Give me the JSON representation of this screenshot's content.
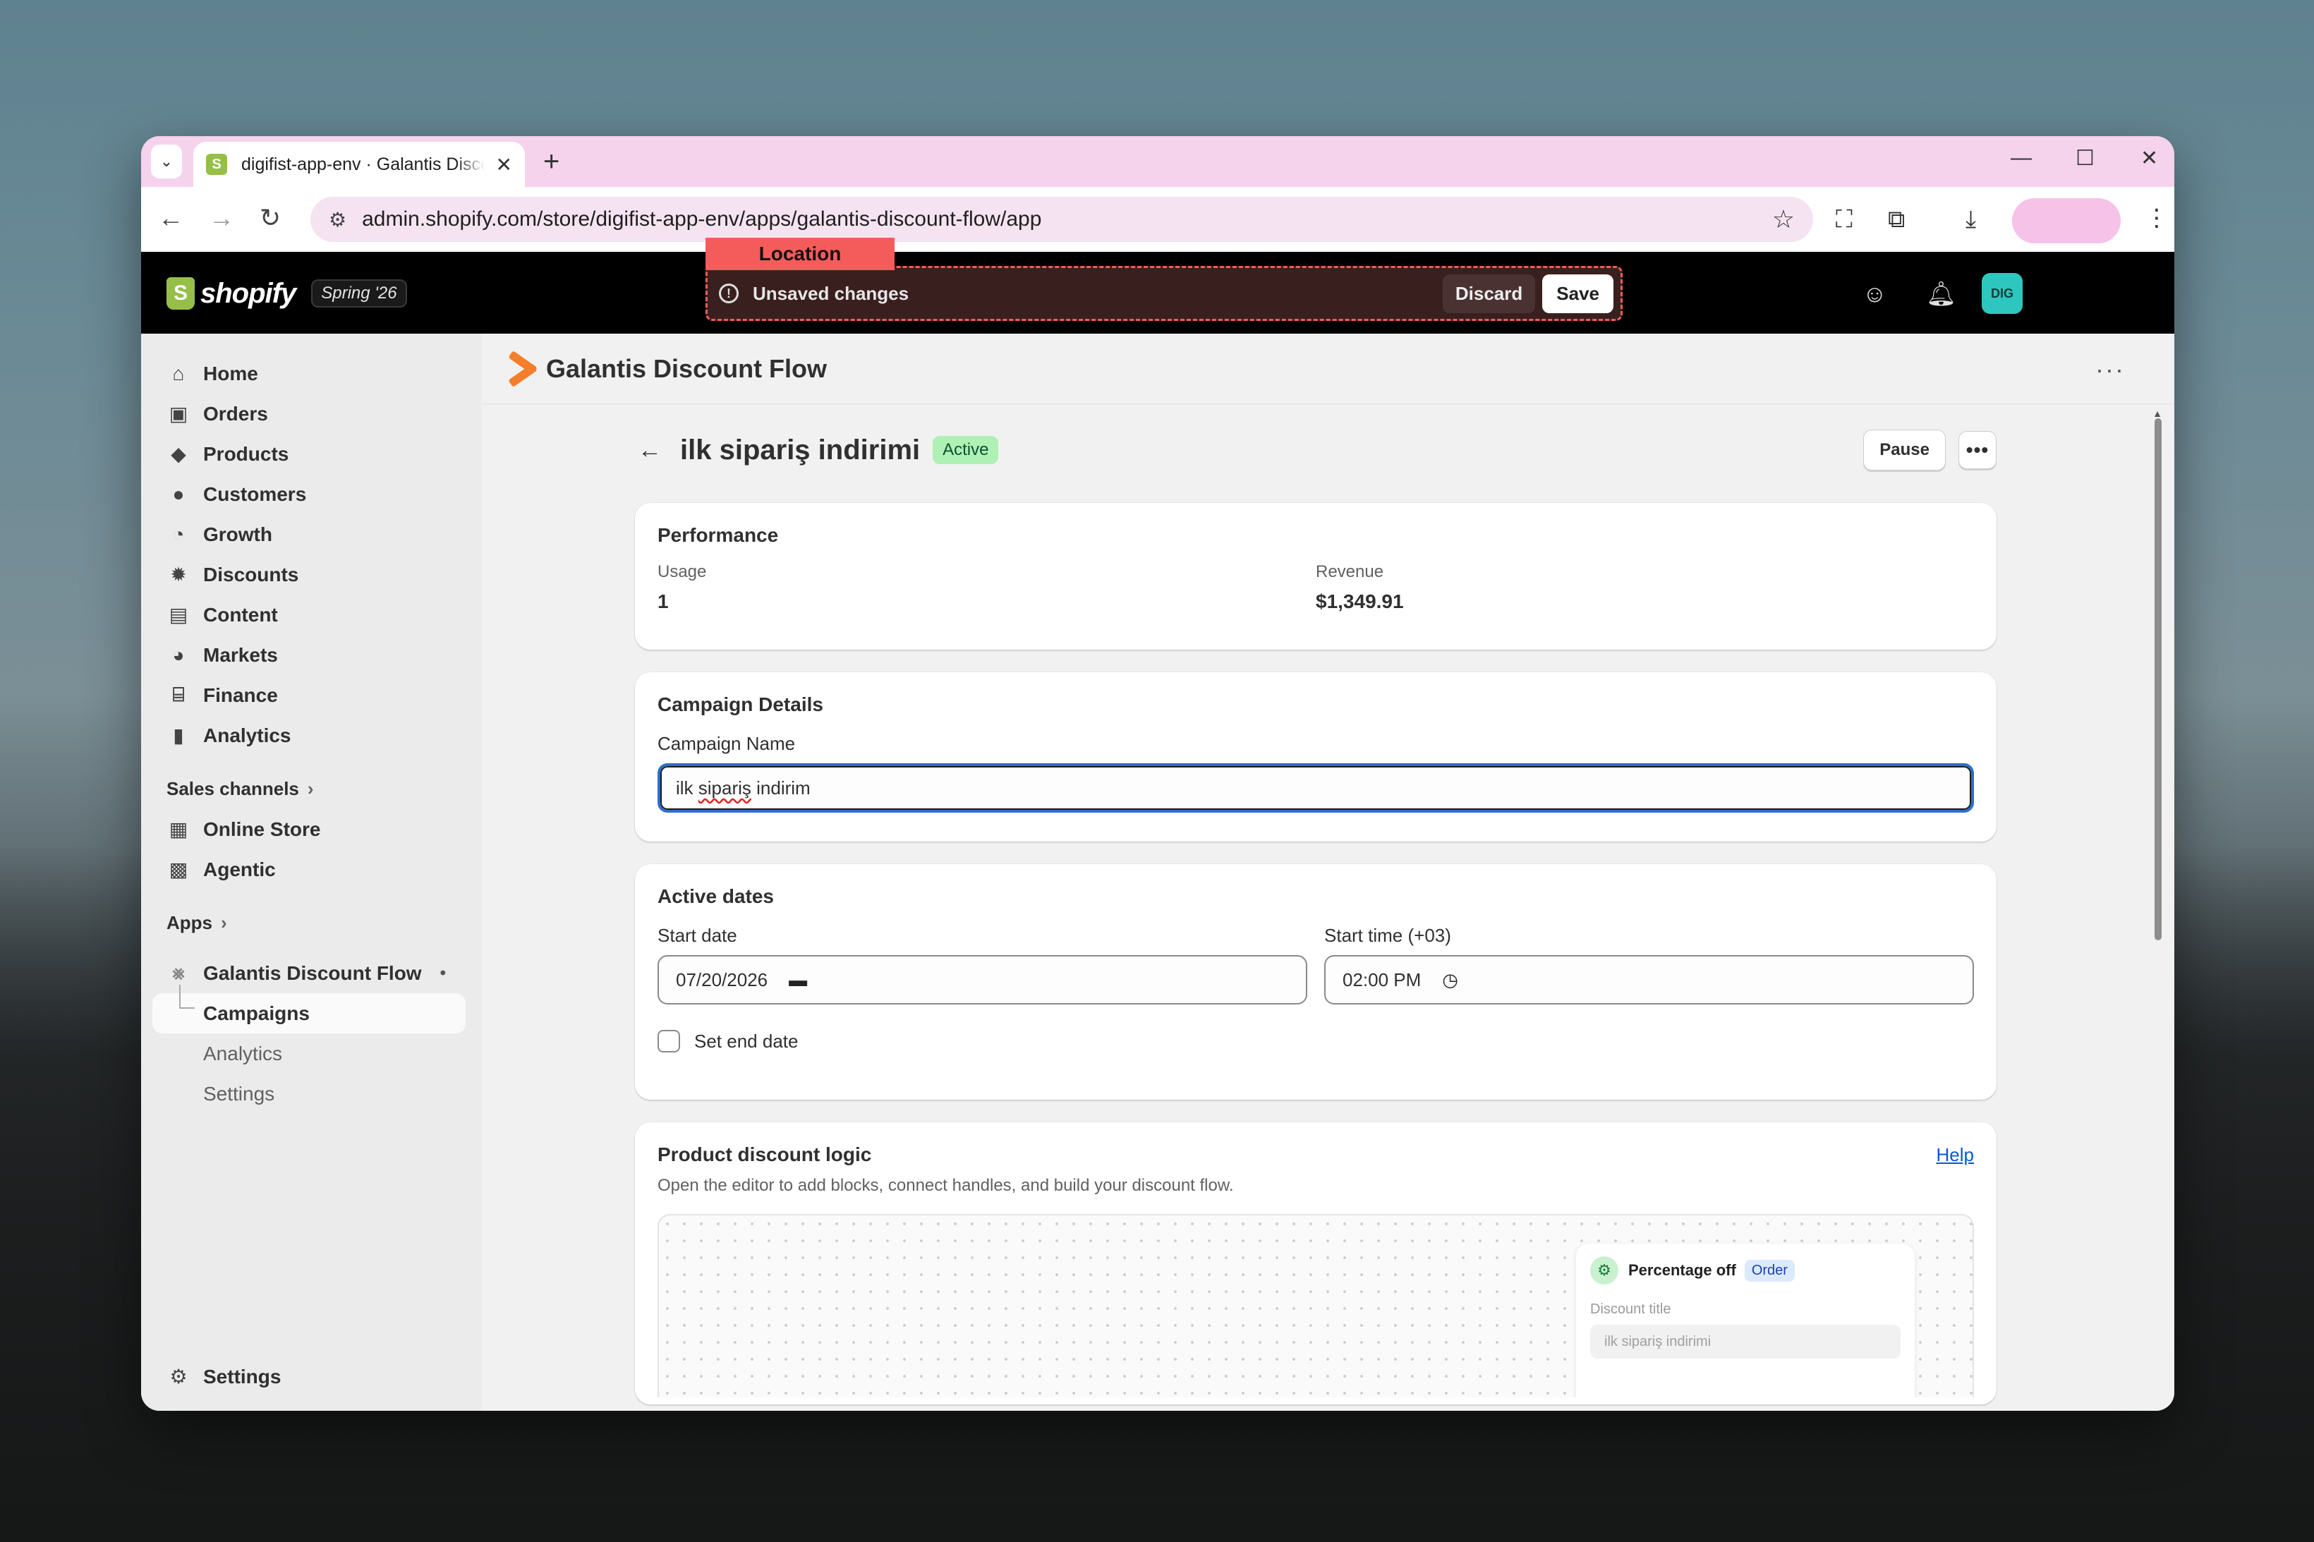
{
  "browser": {
    "tab_title": "digifist-app-env · Galantis Discount Flow",
    "url": "admin.shopify.com/store/digifist-app-env/apps/galantis-discount-flow/app"
  },
  "topbar": {
    "brand": "shopify",
    "edition": "Spring '26",
    "location_label": "Location",
    "unsaved_text": "Unsaved changes",
    "discard_label": "Discard",
    "save_label": "Save",
    "avatar_initials": "DIG"
  },
  "sidebar": {
    "items": [
      {
        "label": "Home",
        "icon": "home-icon"
      },
      {
        "label": "Orders",
        "icon": "orders-icon"
      },
      {
        "label": "Products",
        "icon": "tag-icon"
      },
      {
        "label": "Customers",
        "icon": "person-icon"
      },
      {
        "label": "Growth",
        "icon": "growth-icon"
      },
      {
        "label": "Discounts",
        "icon": "discount-icon"
      },
      {
        "label": "Content",
        "icon": "content-icon"
      },
      {
        "label": "Markets",
        "icon": "globe-icon"
      },
      {
        "label": "Finance",
        "icon": "bank-icon"
      },
      {
        "label": "Analytics",
        "icon": "bar-chart-icon"
      }
    ],
    "sales_channels_label": "Sales channels",
    "channels": [
      {
        "label": "Online Store",
        "icon": "store-icon"
      },
      {
        "label": "Agentic",
        "icon": "agentic-icon"
      }
    ],
    "apps_label": "Apps",
    "app_name": "Galantis Discount Flow",
    "app_subitems": [
      "Campaigns",
      "Analytics",
      "Settings"
    ],
    "settings_label": "Settings"
  },
  "app": {
    "title": "Galantis Discount Flow"
  },
  "page": {
    "title": "ilk sipariş indirimi",
    "status": "Active",
    "pause_label": "Pause",
    "more_label": "•••"
  },
  "performance": {
    "title": "Performance",
    "usage_label": "Usage",
    "usage_value": "1",
    "revenue_label": "Revenue",
    "revenue_value": "$1,349.91"
  },
  "campaign_details": {
    "title": "Campaign Details",
    "name_label": "Campaign Name",
    "name_before": "ilk ",
    "name_misspelled": "sipariş",
    "name_after": " indirim"
  },
  "active_dates": {
    "title": "Active dates",
    "start_date_label": "Start date",
    "start_date_value": "07/20/2026",
    "start_time_label": "Start time (+03)",
    "start_time_value": "02:00 PM",
    "end_date_label": "Set end date"
  },
  "logic": {
    "title": "Product discount logic",
    "help_label": "Help",
    "subtitle": "Open the editor to add blocks, connect handles, and build your discount flow.",
    "node_title": "Percentage off",
    "node_badge": "Order",
    "node_field_label": "Discount title",
    "node_field_value": "ilk sipariş indirimi"
  }
}
